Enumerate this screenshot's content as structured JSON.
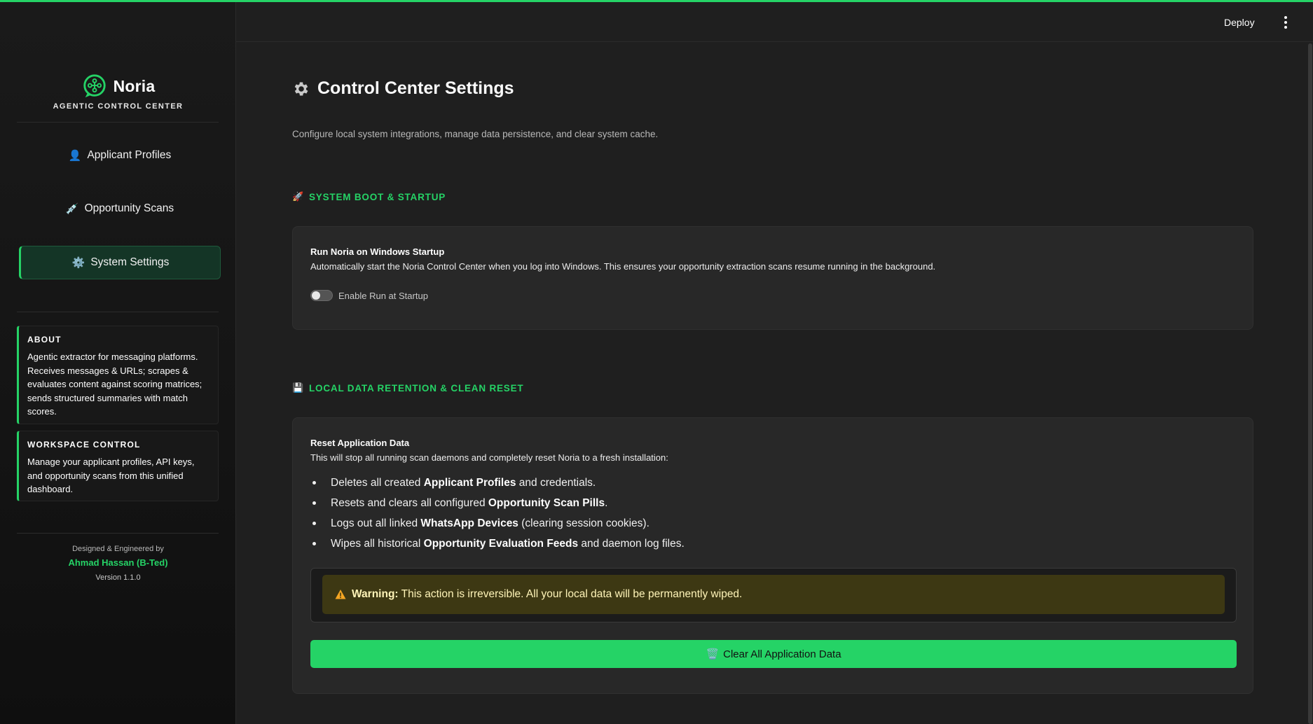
{
  "colors": {
    "accent": "#25d366",
    "background": "#1f1f1f",
    "card": "#282828",
    "warning_bg": "#3d3813"
  },
  "brand": {
    "name": "Noria",
    "subtitle": "AGENTIC CONTROL CENTER",
    "logo_icon": "noria-logo-icon"
  },
  "sidebar": {
    "nav": [
      {
        "icon": "👤",
        "label": "Applicant Profiles",
        "active": false
      },
      {
        "icon": "💉",
        "label": "Opportunity Scans",
        "active": false
      },
      {
        "icon": "⚙️",
        "label": "System Settings",
        "active": true
      }
    ],
    "about": {
      "title": "ABOUT",
      "text": "Agentic extractor for messaging platforms. Receives messages & URLs; scrapes & evaluates content against scoring matrices; sends structured summaries with match scores."
    },
    "workspace": {
      "title": "WORKSPACE CONTROL",
      "text": "Manage your applicant profiles, API keys, and opportunity scans from this unified dashboard."
    },
    "credits": {
      "line1": "Designed & Engineered by",
      "author": "Ahmad Hassan (B-Ted)",
      "version": "Version 1.1.0"
    }
  },
  "header": {
    "deploy_label": "Deploy",
    "menu_icon": "more-vertical-icon"
  },
  "main": {
    "title": "Control Center Settings",
    "description": "Configure local system integrations, manage data persistence, and clear system cache.",
    "startup_section": {
      "icon": "🚀",
      "heading": "SYSTEM BOOT & STARTUP",
      "setting_title": "Run Noria on Windows Startup",
      "setting_desc": "Automatically start the Noria Control Center when you log into Windows. This ensures your opportunity extraction scans resume running in the background.",
      "toggle_label": "Enable Run at Startup",
      "toggle_on": false
    },
    "retention_section": {
      "icon": "💾",
      "heading": "LOCAL DATA RETENTION & CLEAN RESET",
      "setting_title": "Reset Application Data",
      "setting_desc": "This will stop all running scan daemons and completely reset Noria to a fresh installation:",
      "bullets": [
        {
          "pre": "Deletes all created ",
          "bold": "Applicant Profiles",
          "post": " and credentials."
        },
        {
          "pre": "Resets and clears all configured ",
          "bold": "Opportunity Scan Pills",
          "post": "."
        },
        {
          "pre": "Logs out all linked ",
          "bold": "WhatsApp Devices",
          "post": " (clearing session cookies)."
        },
        {
          "pre": "Wipes all historical ",
          "bold": "Opportunity Evaluation Feeds",
          "post": " and daemon log files."
        }
      ],
      "warning_label": "Warning:",
      "warning_text": " This action is irreversible. All your local data will be permanently wiped.",
      "clear_button_icon": "🗑️",
      "clear_button_label": "Clear All Application Data"
    }
  }
}
